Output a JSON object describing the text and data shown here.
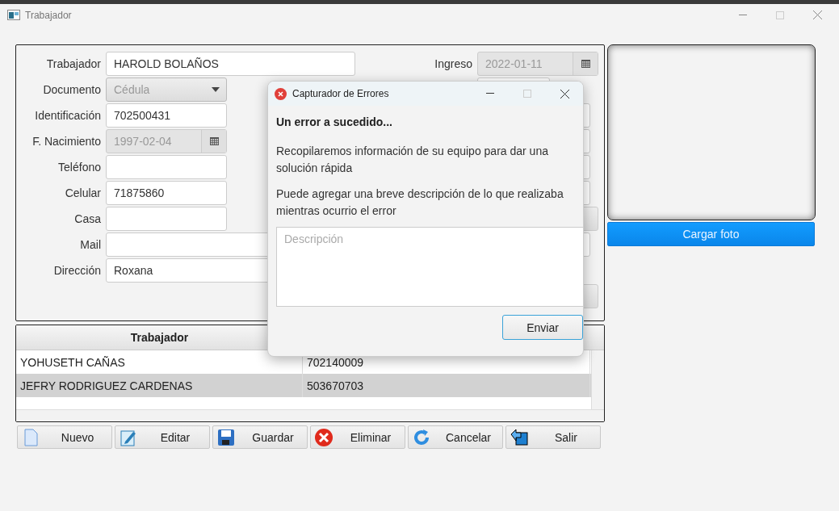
{
  "window": {
    "title": "Trabajador"
  },
  "form": {
    "fields": [
      {
        "label": "Trabajador",
        "kind": "text",
        "value": "HAROLD BOLAÑOS",
        "wide": true
      },
      {
        "label": "Documento",
        "kind": "combo",
        "value": "Cédula",
        "disabled": true
      },
      {
        "label": "Identificación",
        "kind": "text",
        "value": "702500431"
      },
      {
        "label": "F. Nacimiento",
        "kind": "date",
        "value": "1997-02-04",
        "disabled": true
      },
      {
        "label": "Teléfono",
        "kind": "text"
      },
      {
        "label": "Celular",
        "kind": "text",
        "value": "71875860"
      },
      {
        "label": "Casa",
        "kind": "text"
      },
      {
        "label": "Mail",
        "kind": "text",
        "wide": true
      },
      {
        "label": "Dirección",
        "kind": "text",
        "value": "Roxana",
        "wide": true
      }
    ],
    "ingreso": {
      "label": "Ingreso",
      "value": "2022-01-11",
      "disabled": true
    },
    "side_fields": [
      {
        "kind": "short"
      },
      {
        "kind": "text"
      },
      {
        "kind": "text"
      },
      {
        "kind": "text"
      },
      {
        "kind": "text"
      },
      {
        "kind": "combo"
      },
      {
        "kind": "text"
      },
      {
        "kind": "gap"
      },
      {
        "kind": "combo"
      }
    ]
  },
  "photo": {
    "button": "Cargar foto"
  },
  "table": {
    "columns": [
      "Trabajador"
    ],
    "rows": [
      {
        "name": "YOHUSETH CAÑAS",
        "id": "702140009",
        "selected": false
      },
      {
        "name": "JEFRY RODRIGUEZ CARDENAS",
        "id": "503670703",
        "selected": true
      }
    ]
  },
  "buttons": [
    {
      "label": "Nuevo",
      "kind": "new"
    },
    {
      "label": "Editar",
      "kind": "edit"
    },
    {
      "label": "Guardar",
      "kind": "save"
    },
    {
      "label": "Eliminar",
      "kind": "delete"
    },
    {
      "label": "Cancelar",
      "kind": "cancel"
    },
    {
      "label": "Salir",
      "kind": "exit"
    }
  ],
  "dialog": {
    "title": "Capturador de Errores",
    "heading": "Un error a sucedido...",
    "paragraphs": [
      "Recopilaremos información de su equipo para dar una solución rápida",
      "Puede agregar una breve descripción de lo que realizaba mientras ocurrio el error"
    ],
    "placeholder": "Descripción",
    "button": "Enviar"
  }
}
